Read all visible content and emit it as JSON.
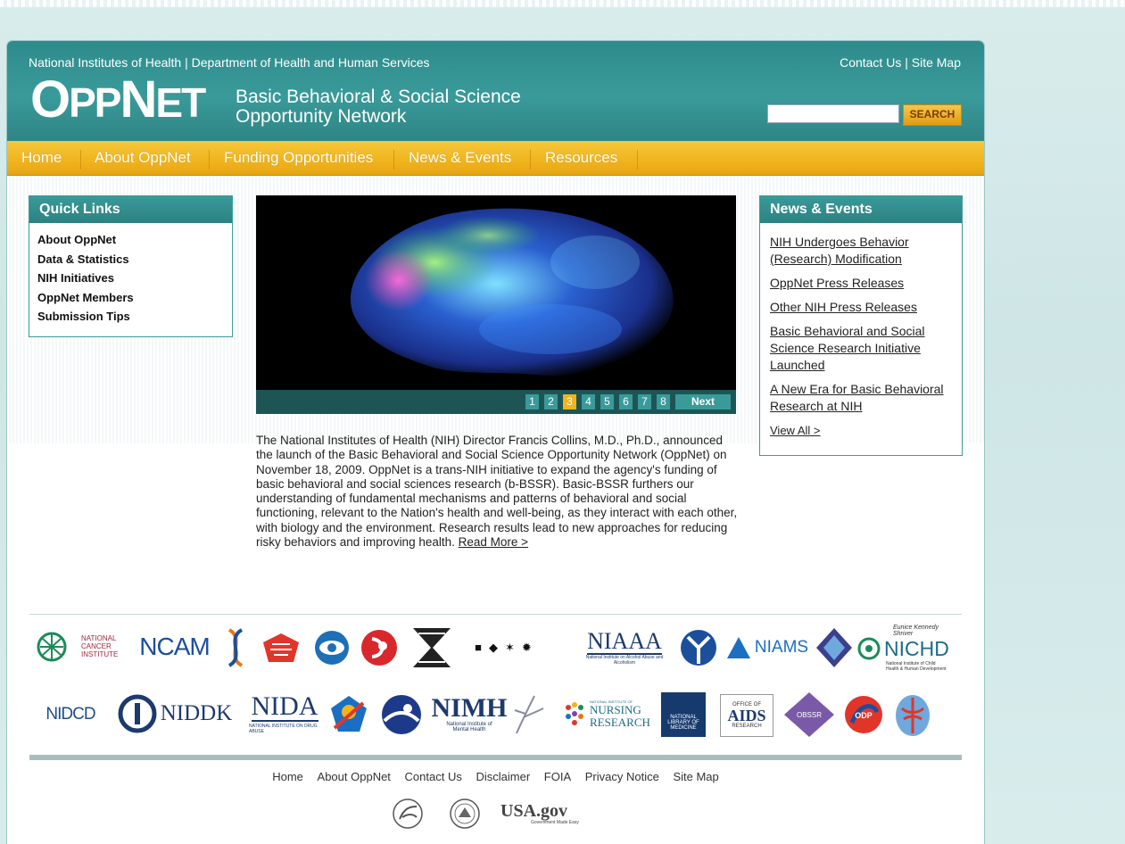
{
  "header": {
    "agency_text": "National Institutes of Health | Department of Health and Human Services",
    "contact_label": "Contact Us",
    "sitemap_label": "Site Map",
    "separator": "|",
    "logo_text_op": "O",
    "logo_text_pp": "PP",
    "logo_text_n": "N",
    "logo_text_et": "ET",
    "logo_sub_line1": "Basic Behavioral & Social Science",
    "logo_sub_line2": "Opportunity Network",
    "search_placeholder": "",
    "search_value": "",
    "search_button": "SEARCH"
  },
  "nav": {
    "items": [
      "Home",
      "About OppNet",
      "Funding Opportunities",
      "News & Events",
      "Resources"
    ]
  },
  "quick_links": {
    "title": "Quick Links",
    "items": [
      "About OppNet",
      "Data & Statistics",
      "NIH Initiatives",
      "OppNet Members",
      "Submission Tips"
    ]
  },
  "slider": {
    "pages": [
      "1",
      "2",
      "3",
      "4",
      "5",
      "6",
      "7",
      "8"
    ],
    "active_page": "3",
    "next_label": "Next"
  },
  "intro": {
    "text": "The National Institutes of Health (NIH) Director Francis Collins, M.D., Ph.D., announced the launch of the Basic Behavioral and Social Science Opportunity Network (OppNet) on November 18, 2009. OppNet is a trans-NIH initiative to expand the agency's funding of basic behavioral and social sciences research (b-BSSR). Basic-BSSR furthers our understanding of fundamental mechanisms and patterns of behavioral and social functioning, relevant to the Nation's health and well-being, as they interact with each other, with biology and the environment. Research results lead to new approaches for reducing risky behaviors and improving health.",
    "read_more": "Read More >"
  },
  "news": {
    "title": "News & Events",
    "items": [
      "NIH Undergoes Behavior (Research) Modification",
      "OppNet Press Releases",
      "Other NIH Press Releases",
      "Basic Behavioral and Social Science Research Initiative Launched",
      "A New Era for Basic Behavioral Research at NIH"
    ],
    "view_all": "View All >"
  },
  "logos_row1": {
    "nci": "NATIONAL CANCER INSTITUTE",
    "ncam": "NCAM",
    "niaaa": "NIAAA",
    "niaaa_sub": "National Institute on Alcohol Abuse and Alcoholism",
    "niams": "NIAMS",
    "nibib": "NIBIB",
    "nichd": "NICHD",
    "nichd_top": "Eunice Kennedy Shriver",
    "nichd_sub": "National Institute of Child Health & Human Development"
  },
  "logos_row2": {
    "nidcd": "NIDCD",
    "niddk": "NIDDK",
    "nida": "NIDA",
    "nida_sub": "NATIONAL INSTITUTE ON DRUG ABUSE",
    "nimh": "NIMH",
    "nimh_sub": "National Institute of Mental Health",
    "ninr_top": "NATIONAL INSTITUTE OF",
    "ninr": "NURSING RESEARCH",
    "nlm": "NATIONAL LIBRARY OF MEDICINE",
    "oar_top": "OFFICE OF",
    "oar": "AIDS",
    "oar_sub": "RESEARCH",
    "obssr": "OBSSR",
    "odp": "ODP"
  },
  "footer": {
    "links": [
      "Home",
      "About OppNet",
      "Contact Us",
      "Disclaimer",
      "FOIA",
      "Privacy Notice",
      "Site Map"
    ],
    "usagov": "USA.gov",
    "usagov_sub": "Government Made Easy",
    "nih_seal": "NATIONAL INSTITUTES OF HEALTH"
  },
  "colors": {
    "teal": "#2e8b8b",
    "gold": "#f0b41e",
    "nav_text": "#ffffff"
  }
}
